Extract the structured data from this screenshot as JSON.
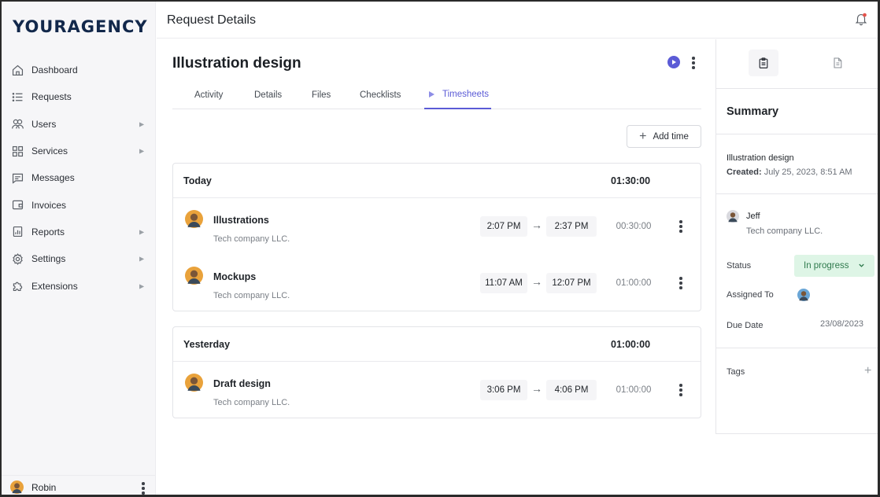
{
  "brand": "YOURAGENCY",
  "sidebar": {
    "items": [
      {
        "label": "Dashboard",
        "icon": "home-icon"
      },
      {
        "label": "Requests",
        "icon": "list-icon"
      },
      {
        "label": "Users",
        "icon": "users-icon",
        "has_submenu": true
      },
      {
        "label": "Services",
        "icon": "grid-icon",
        "has_submenu": true
      },
      {
        "label": "Messages",
        "icon": "chat-icon"
      },
      {
        "label": "Invoices",
        "icon": "wallet-icon"
      },
      {
        "label": "Reports",
        "icon": "report-icon",
        "has_submenu": true
      },
      {
        "label": "Settings",
        "icon": "gear-icon",
        "has_submenu": true
      },
      {
        "label": "Extensions",
        "icon": "puzzle-icon",
        "has_submenu": true
      }
    ],
    "user_name": "Robin"
  },
  "header": {
    "title": "Request Details"
  },
  "request": {
    "title": "Illustration design",
    "tabs": [
      "Activity",
      "Details",
      "Files",
      "Checklists",
      "Timesheets"
    ],
    "active_tab": "Timesheets",
    "add_time_label": "Add time"
  },
  "timesheets": [
    {
      "day": "Today",
      "total": "01:30:00",
      "entries": [
        {
          "name": "Illustrations",
          "company": "Tech company LLC.",
          "start": "2:07 PM",
          "end": "2:37 PM",
          "duration": "00:30:00"
        },
        {
          "name": "Mockups",
          "company": "Tech company LLC.",
          "start": "11:07 AM",
          "end": "12:07 PM",
          "duration": "01:00:00"
        }
      ]
    },
    {
      "day": "Yesterday",
      "total": "01:00:00",
      "entries": [
        {
          "name": "Draft design",
          "company": "Tech company LLC.",
          "start": "3:06 PM",
          "end": "4:06 PM",
          "duration": "01:00:00"
        }
      ]
    }
  ],
  "summary": {
    "title": "Summary",
    "request_name": "Illustration design",
    "created_label": "Created:",
    "created_value": "July 25, 2023, 8:51 AM",
    "client_name": "Jeff",
    "client_company": "Tech company LLC.",
    "status_label": "Status",
    "status_value": "In progress",
    "assigned_label": "Assigned To",
    "due_label": "Due Date",
    "due_value": "23/08/2023",
    "tags_label": "Tags"
  },
  "colors": {
    "accent": "#5b5bd6",
    "status_bg": "#def5e6",
    "status_text": "#2f7a4d",
    "brand": "#12284b"
  }
}
